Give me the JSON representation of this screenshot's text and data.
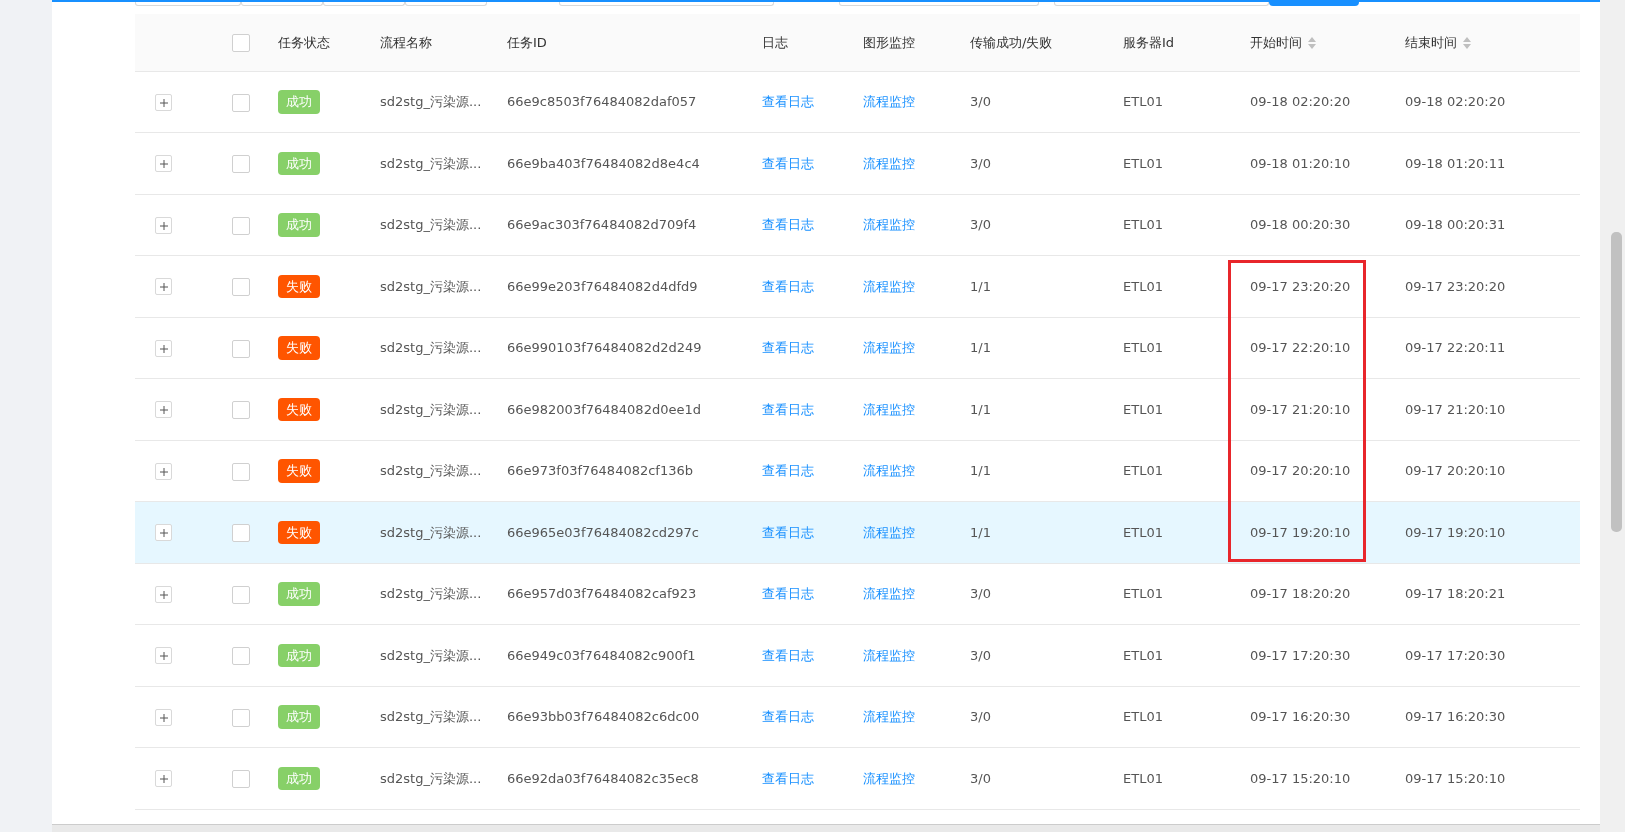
{
  "table": {
    "columns": [
      {
        "kind": "expand"
      },
      {
        "kind": "select"
      },
      {
        "label": "任务状态",
        "kind": "status"
      },
      {
        "label": "流程名称",
        "kind": "text"
      },
      {
        "label": "任务ID",
        "kind": "text"
      },
      {
        "label": "日志",
        "kind": "link"
      },
      {
        "label": "图形监控",
        "kind": "link"
      },
      {
        "label": "传输成功/失败",
        "kind": "text"
      },
      {
        "label": "服务器Id",
        "kind": "text"
      },
      {
        "label": "开始时间",
        "kind": "text",
        "sortable": true
      },
      {
        "label": "结束时间",
        "kind": "text",
        "sortable": true
      }
    ],
    "header_checked": false,
    "rows": [
      {
        "selected": false,
        "checked": false,
        "boxed": false,
        "status": "成功",
        "color": "#87d068",
        "name": "sd2stg_污染源...",
        "id": "66e9c8503f76484082daf057",
        "log": "查看日志",
        "monitor": "流程监控",
        "transfer": "3/0",
        "server": "ETL01",
        "start": "09-18 02:20:20",
        "end": "09-18 02:20:20"
      },
      {
        "selected": false,
        "checked": false,
        "boxed": false,
        "status": "成功",
        "color": "#87d068",
        "name": "sd2stg_污染源...",
        "id": "66e9ba403f76484082d8e4c4",
        "log": "查看日志",
        "monitor": "流程监控",
        "transfer": "3/0",
        "server": "ETL01",
        "start": "09-18 01:20:10",
        "end": "09-18 01:20:11"
      },
      {
        "selected": false,
        "checked": false,
        "boxed": false,
        "status": "成功",
        "color": "#87d068",
        "name": "sd2stg_污染源...",
        "id": "66e9ac303f76484082d709f4",
        "log": "查看日志",
        "monitor": "流程监控",
        "transfer": "3/0",
        "server": "ETL01",
        "start": "09-18 00:20:30",
        "end": "09-18 00:20:31"
      },
      {
        "selected": false,
        "checked": false,
        "boxed": true,
        "status": "失败",
        "color": "#ff5500",
        "name": "sd2stg_污染源...",
        "id": "66e99e203f76484082d4dfd9",
        "log": "查看日志",
        "monitor": "流程监控",
        "transfer": "1/1",
        "server": "ETL01",
        "start": "09-17 23:20:20",
        "end": "09-17 23:20:20"
      },
      {
        "selected": false,
        "checked": false,
        "boxed": true,
        "status": "失败",
        "color": "#ff5500",
        "name": "sd2stg_污染源...",
        "id": "66e990103f76484082d2d249",
        "log": "查看日志",
        "monitor": "流程监控",
        "transfer": "1/1",
        "server": "ETL01",
        "start": "09-17 22:20:10",
        "end": "09-17 22:20:11"
      },
      {
        "selected": false,
        "checked": false,
        "boxed": true,
        "status": "失败",
        "color": "#ff5500",
        "name": "sd2stg_污染源...",
        "id": "66e982003f76484082d0ee1d",
        "log": "查看日志",
        "monitor": "流程监控",
        "transfer": "1/1",
        "server": "ETL01",
        "start": "09-17 21:20:10",
        "end": "09-17 21:20:10"
      },
      {
        "selected": false,
        "checked": false,
        "boxed": true,
        "status": "失败",
        "color": "#ff5500",
        "name": "sd2stg_污染源...",
        "id": "66e973f03f76484082cf136b",
        "log": "查看日志",
        "monitor": "流程监控",
        "transfer": "1/1",
        "server": "ETL01",
        "start": "09-17 20:20:10",
        "end": "09-17 20:20:10"
      },
      {
        "selected": true,
        "checked": false,
        "boxed": true,
        "status": "失败",
        "color": "#ff5500",
        "name": "sd2stg_污染源...",
        "id": "66e965e03f76484082cd297c",
        "log": "查看日志",
        "monitor": "流程监控",
        "transfer": "1/1",
        "server": "ETL01",
        "start": "09-17 19:20:10",
        "end": "09-17 19:20:10"
      },
      {
        "selected": false,
        "checked": false,
        "boxed": false,
        "status": "成功",
        "color": "#87d068",
        "name": "sd2stg_污染源...",
        "id": "66e957d03f76484082caf923",
        "log": "查看日志",
        "monitor": "流程监控",
        "transfer": "3/0",
        "server": "ETL01",
        "start": "09-17 18:20:20",
        "end": "09-17 18:20:21"
      },
      {
        "selected": false,
        "checked": false,
        "boxed": false,
        "status": "成功",
        "color": "#87d068",
        "name": "sd2stg_污染源...",
        "id": "66e949c03f76484082c900f1",
        "log": "查看日志",
        "monitor": "流程监控",
        "transfer": "3/0",
        "server": "ETL01",
        "start": "09-17 17:20:30",
        "end": "09-17 17:20:30"
      },
      {
        "selected": false,
        "checked": false,
        "boxed": false,
        "status": "成功",
        "color": "#87d068",
        "name": "sd2stg_污染源...",
        "id": "66e93bb03f76484082c6dc00",
        "log": "查看日志",
        "monitor": "流程监控",
        "transfer": "3/0",
        "server": "ETL01",
        "start": "09-17 16:20:30",
        "end": "09-17 16:20:30"
      },
      {
        "selected": false,
        "checked": false,
        "boxed": false,
        "status": "成功",
        "color": "#87d068",
        "name": "sd2stg_污染源...",
        "id": "66e92da03f76484082c35ec8",
        "log": "查看日志",
        "monitor": "流程监控",
        "transfer": "3/0",
        "server": "ETL01",
        "start": "09-17 15:20:10",
        "end": "09-17 15:20:10"
      }
    ]
  }
}
